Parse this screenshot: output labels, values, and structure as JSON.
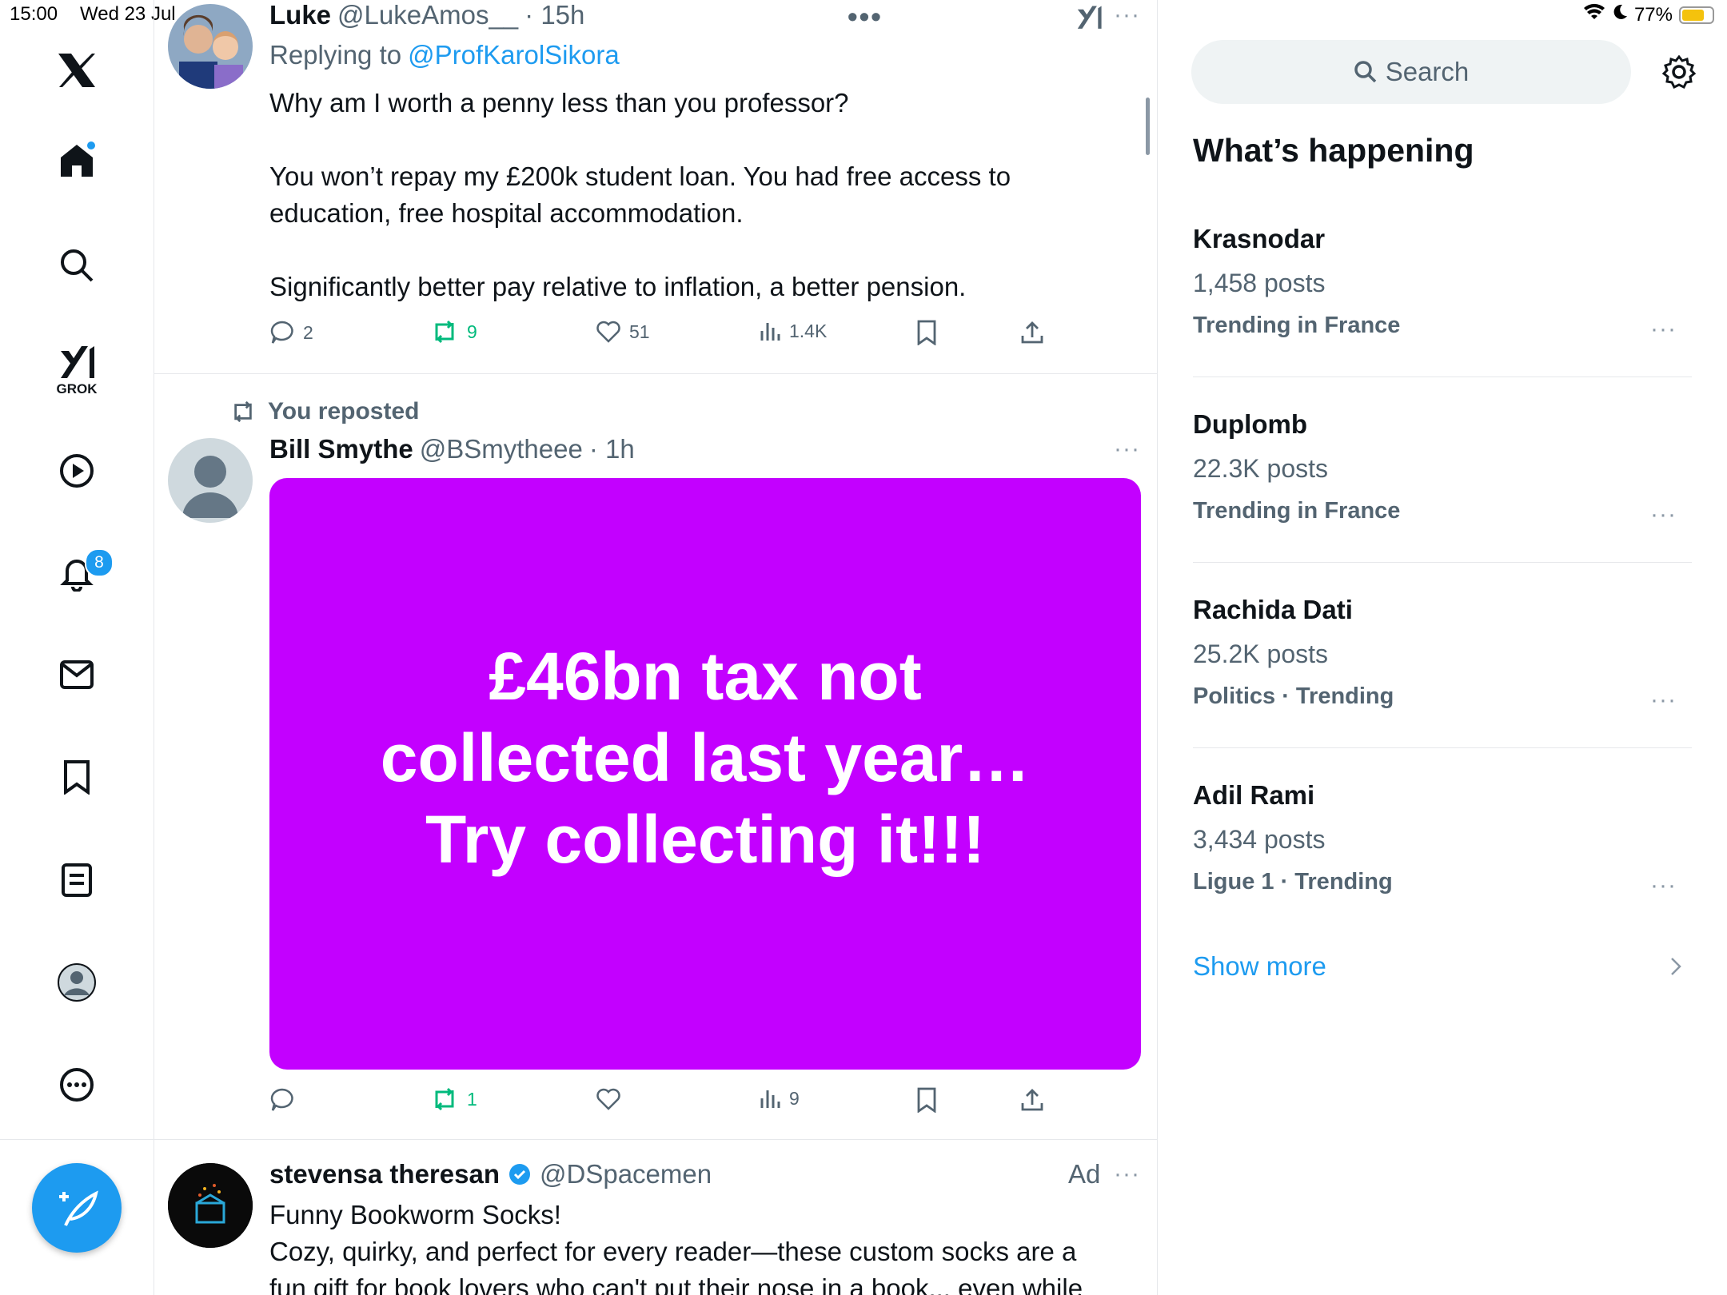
{
  "status": {
    "time": "15:00",
    "date": "Wed 23 Jul",
    "battery": "77%",
    "battery_level": 0.77
  },
  "nav": {
    "grok_label": "GROK",
    "notifications_badge": "8"
  },
  "feed": {
    "tweet1": {
      "name": "Luke",
      "handle": "@LukeAmos__",
      "time": "· 15h",
      "replying_prefix": "Replying to",
      "replying_handle": "@ProfKarolSikora",
      "p1": "Why am I worth a penny less than you professor?",
      "p2": "You won’t repay my £200k student loan. You had free access to education, free hospital accommodation.",
      "p3": "Significantly better pay relative to inflation, a better pension.",
      "replies": "2",
      "reposts": "9",
      "likes": "51",
      "views": "1.4K"
    },
    "tweet2": {
      "repost_label": "You reposted",
      "name": "Bill Smythe",
      "handle": "@BSmytheee",
      "time": "· 1h",
      "image_text": "£46bn tax not collected last year… Try collecting it!!!",
      "image_color": "#c300ff",
      "reposts": "1",
      "views": "9"
    },
    "tweet3": {
      "name": "stevensa theresan",
      "handle": "@DSpacemen",
      "ad_label": "Ad",
      "line1": "Funny Bookworm Socks!",
      "line2": "Cozy, quirky, and perfect for every reader—these custom socks are a",
      "line3": "fun gift for book lovers who can't put their nose in a book... even while"
    }
  },
  "right": {
    "search_placeholder": "Search",
    "heading": "What’s happening",
    "trends": [
      {
        "title": "Krasnodar",
        "count": "1,458 posts",
        "context": "Trending in France"
      },
      {
        "title": "Duplomb",
        "count": "22.3K posts",
        "context": "Trending in France"
      },
      {
        "title": "Rachida Dati",
        "count": "25.2K posts",
        "context": "Politics · Trending"
      },
      {
        "title": "Adil Rami",
        "count": "3,434 posts",
        "context": "Ligue 1 · Trending"
      }
    ],
    "show_more": "Show more"
  },
  "colors": {
    "accent": "#1d9bf0",
    "repost_green": "#00ba7c",
    "muted": "#536471"
  }
}
